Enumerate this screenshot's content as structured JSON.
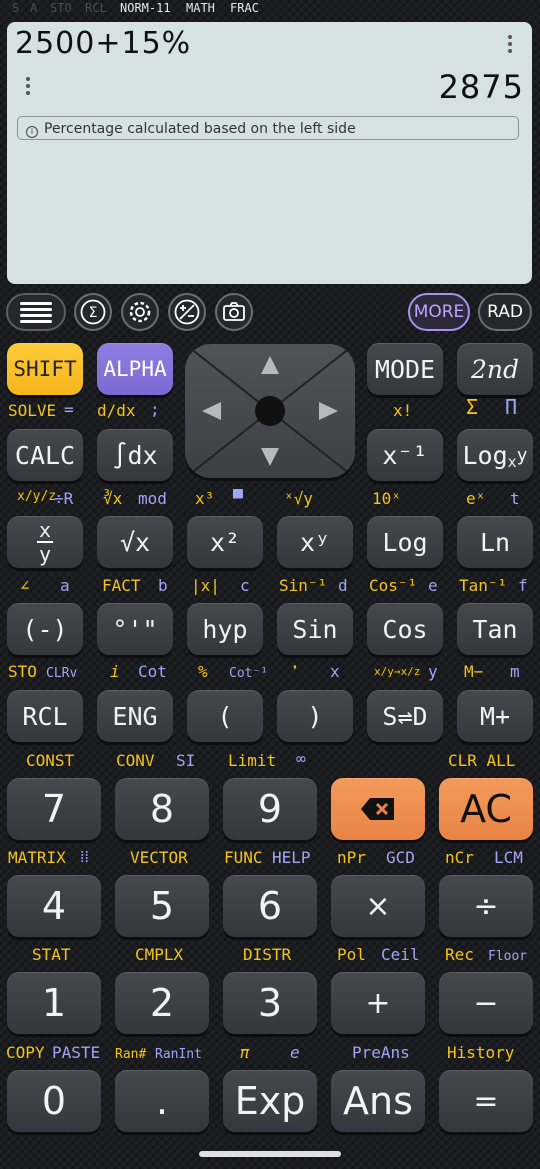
{
  "status": {
    "items": [
      "S",
      "A",
      "STO",
      "RCL",
      "NORM-11",
      "MATH",
      "FRAC"
    ]
  },
  "display": {
    "expression": "2500+15%",
    "result": "2875",
    "notice": "Percentage calculated based on the left side"
  },
  "toolbar": {
    "more": "MORE",
    "rad": "RAD"
  },
  "keys": {
    "shift": "SHIFT",
    "alpha": "ALPHA",
    "mode": "MODE",
    "second": "2nd",
    "calc": "CALC",
    "integral": "∫dx",
    "inverse": "x⁻¹",
    "logxy": "Log",
    "frac_num": "x",
    "frac_den": "y",
    "sqrt": "√x",
    "square": "x²",
    "power": "xʸ",
    "log": "Log",
    "ln": "Ln",
    "neg": "(-)",
    "dms": "°'\"",
    "hyp": "hyp",
    "sin": "Sin",
    "cos": "Cos",
    "tan": "Tan",
    "rcl": "RCL",
    "eng": "ENG",
    "lparen": "(",
    "rparen": ")",
    "sd": "S⇌D",
    "mplus": "M+",
    "k7": "7",
    "k8": "8",
    "k9": "9",
    "ac": "AC",
    "k4": "4",
    "k5": "5",
    "k6": "6",
    "mul": "×",
    "div": "÷",
    "k1": "1",
    "k2": "2",
    "k3": "3",
    "plus": "+",
    "minus": "−",
    "k0": "0",
    "dot": ".",
    "exp": "Exp",
    "ans": "Ans",
    "eq": "="
  },
  "labels": {
    "solve": "SOLVE",
    "solve_eq": "=",
    "ddx": "d/dx",
    "semicolon": ";",
    "xfact": "x!",
    "sigma": "Σ",
    "pi_prod": "Π",
    "xyz": "x/y/z",
    "divR": "÷R",
    "cuberoot": "∛x",
    "mod": "mod",
    "cube": "x³",
    "xbar": "▀",
    "xrooty": "ˣ√y",
    "ten_x": "10ˣ",
    "e_x": "eˣ",
    "t": "t",
    "angle": "∠",
    "a": "a",
    "fact": "FACT",
    "b": "b",
    "abs": "|x|",
    "c": "c",
    "sin_inv": "Sin⁻¹",
    "d": "d",
    "cos_inv": "Cos⁻¹",
    "e": "e",
    "tan_inv": "Tan⁻¹",
    "f": "f",
    "sto": "STO",
    "clrv": "CLRv",
    "i": "i",
    "cot": "Cot",
    "percent": "%",
    "cot_inv": "Cot⁻¹",
    "comma": "❜",
    "x": "x",
    "xyconv": "x/y→x/z",
    "y": "y",
    "mminus": "M−",
    "m": "m",
    "const": "CONST",
    "conv": "CONV",
    "si": "SI",
    "limit": "Limit",
    "infinity": "∞",
    "clr_all": "CLR ALL",
    "matrix": "MATRIX",
    "vector": "VECTOR",
    "func": "FUNC",
    "help": "HELP",
    "npr": "nPr",
    "gcd": "GCD",
    "ncr": "nCr",
    "lcm": "LCM",
    "stat": "STAT",
    "cmplx": "CMPLX",
    "distr": "DISTR",
    "pol": "Pol",
    "ceil": "Ceil",
    "rec": "Rec",
    "floor": "Floor",
    "copy": "COPY",
    "paste": "PASTE",
    "ran": "Ran#",
    "ranint": "RanInt",
    "pi": "π",
    "econst": "e",
    "preans": "PreAns",
    "history": "History"
  }
}
